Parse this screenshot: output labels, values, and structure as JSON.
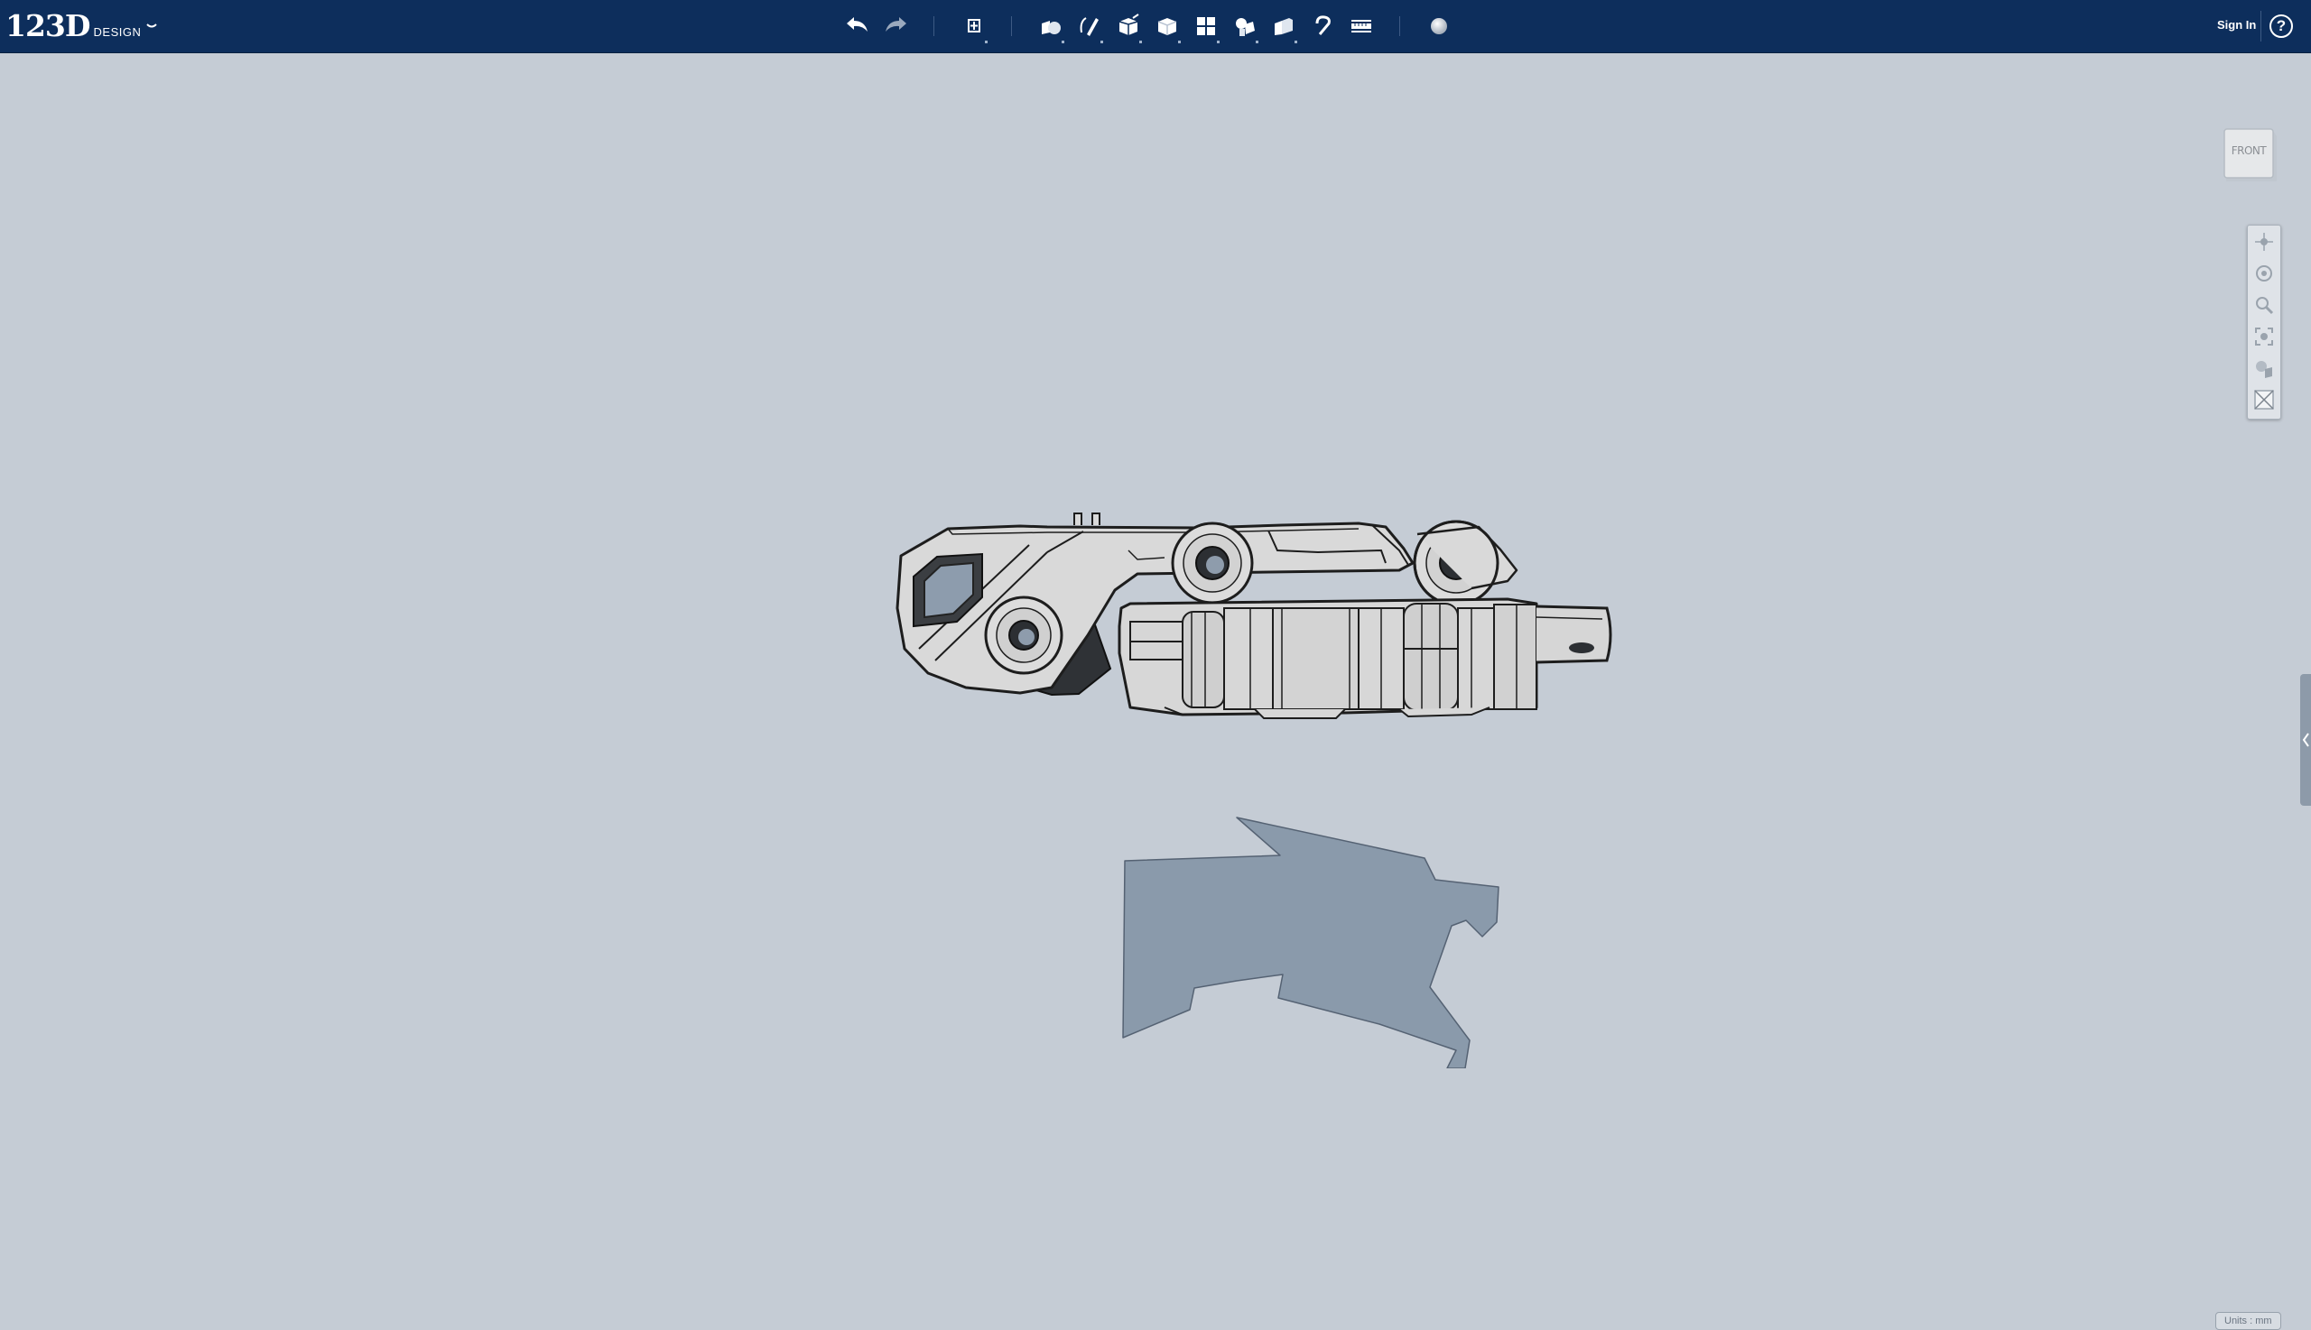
{
  "app": {
    "brand_number": "123D",
    "brand_word": "DESIGN",
    "menu_icon": "chevron-down-icon"
  },
  "toolbar": {
    "tools": [
      "undo-icon",
      "redo-icon",
      "transform-icon",
      "primitives-icon",
      "sketch-icon",
      "construct-icon",
      "modify-icon",
      "pattern-icon",
      "grouping-icon",
      "combine-icon",
      "snap-icon",
      "measure-icon",
      "material-icon"
    ]
  },
  "header": {
    "sign_in": "Sign In",
    "help": "?"
  },
  "viewport": {
    "viewcube_label": "FRONT",
    "nav_tools": [
      "pan-icon",
      "orbit-icon",
      "zoom-icon",
      "fit-icon",
      "view-mode-icon",
      "grid-toggle-icon"
    ],
    "units": "Units : mm"
  },
  "colors": {
    "toolbar_bg": "#0d2e5c",
    "viewport_bg": "#c5ccd5",
    "part_fill": "#d8d8d8",
    "sketch_fill": "#8a9aab"
  }
}
